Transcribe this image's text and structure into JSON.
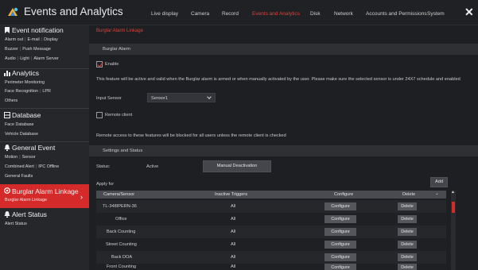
{
  "app": {
    "title": "Events and Analytics",
    "logo_icon": "camera-logo-icon"
  },
  "nav": {
    "tabs": [
      {
        "label": "Live display",
        "active": false
      },
      {
        "label": "Camera",
        "active": false
      },
      {
        "label": "Record",
        "active": false
      },
      {
        "label": "Events and Analytics",
        "active": true
      },
      {
        "label": "Disk",
        "active": false
      },
      {
        "label": "Network",
        "active": false
      },
      {
        "label": "Accounts and Permissions",
        "active": false
      },
      {
        "label": "System",
        "active": false
      }
    ],
    "close_icon": "close-icon"
  },
  "sidebar": {
    "categories": [
      {
        "title": "Event notification",
        "icon": "bookmark-icon",
        "rows": [
          [
            "Alarm out",
            "E-mail",
            "Display"
          ],
          [
            "Buzzer",
            "Push Message"
          ],
          [
            "Audio",
            "Light",
            "Alarm Server"
          ]
        ]
      },
      {
        "title": "Analytics",
        "icon": "analytics-icon",
        "rows": [
          [
            "Perimeter Monitoring"
          ],
          [
            "Face Recognition",
            "LPR"
          ],
          [
            "Others"
          ]
        ]
      },
      {
        "title": "Database",
        "icon": "database-icon",
        "rows": [
          [
            "Face Database"
          ],
          [
            "Vehicle Database"
          ]
        ]
      },
      {
        "title": "General Event",
        "icon": "bell-icon",
        "rows": [
          [
            "Motion",
            "Sensor"
          ],
          [
            "Combined Alert",
            "IPC Offline"
          ],
          [
            "General Faults"
          ]
        ]
      },
      {
        "title": "Burglar Alarm Linkage",
        "icon": "alarm-icon",
        "rows": [
          [
            "Burglar Alarm Linkage"
          ]
        ],
        "active": true
      },
      {
        "title": "Alert Status",
        "icon": "bell-icon",
        "rows": [
          [
            "Alert Status"
          ]
        ]
      }
    ]
  },
  "main": {
    "page_title": "Burglar Alarm Linkage",
    "section_alarm": "Burglar Alarm",
    "enable_label": "Enable",
    "enable_checked": true,
    "description": "This feature will be active and valid when the Burglar alarm is armed or when manually activated by the user. Please make sure the selected sensor is under 24X7 schedule and enabled",
    "input_sensor_label": "Input Sensor",
    "input_sensor_value": "Sensor1",
    "remote_client_label": "Remote client",
    "remote_client_checked": false,
    "remote_note": "Remote access to these features will be blocked for all users unless the remote client is checked",
    "section_settings": "Settings and Status",
    "status_label": "Status:",
    "status_value": "Active",
    "manual_btn": "Manual Deactivation",
    "apply_for": "Apply for",
    "add_btn": "Add",
    "table": {
      "headers": [
        "Camera/Sensor",
        "Inactive Triggers",
        "Configure",
        "Delete"
      ],
      "rows": [
        {
          "name": "TL-348IPERN-36",
          "triggers": "All",
          "configure": "Configure",
          "delete": "Delete"
        },
        {
          "name": "Office",
          "triggers": "All",
          "configure": "Configure",
          "delete": "Delete"
        },
        {
          "name": "Back Counting",
          "triggers": "All",
          "configure": "Configure",
          "delete": "Delete"
        },
        {
          "name": "Street Counting",
          "triggers": "All",
          "configure": "Configure",
          "delete": "Delete"
        },
        {
          "name": "Back DOA",
          "triggers": "All",
          "configure": "Configure",
          "delete": "Delete"
        },
        {
          "name": "Front Counting",
          "triggers": "All",
          "configure": "Configure",
          "delete": "Delete"
        }
      ]
    }
  },
  "colors": {
    "accent": "#d42a2a",
    "active_tab": "#e0403a",
    "background": "#1e1f22"
  }
}
